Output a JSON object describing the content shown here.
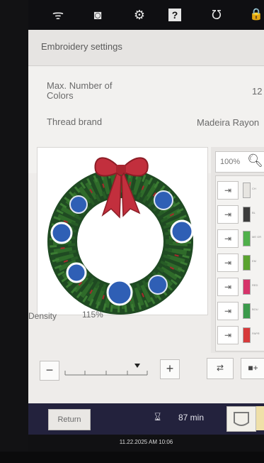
{
  "status_bar": {
    "icons": [
      "wifi-icon",
      "camera-icon",
      "gear-icon",
      "help-icon",
      "machine-icon",
      "lock-icon"
    ],
    "glyphs": [
      "ᯤ",
      "◙",
      "⚙",
      "?",
      "ᘮ",
      "🔒"
    ]
  },
  "header": {
    "title": "Embroidery settings"
  },
  "settings": {
    "max_colors_label_line1": "Max. Number of",
    "max_colors_label_line2": "Colors",
    "max_colors_value": "12",
    "thread_brand_label": "Thread brand",
    "thread_brand_value": "Madeira Rayon"
  },
  "preview": {
    "image": "christmas-wreath-embroidery"
  },
  "zoom": {
    "level": "100%"
  },
  "color_list": {
    "items": [
      {
        "color": "#e7e5e1",
        "name": "CH"
      },
      {
        "color": "#3c3c3c",
        "name": "BL"
      },
      {
        "color": "#4fb04a",
        "name": "ME GR"
      },
      {
        "color": "#5aa32f",
        "name": "EM"
      },
      {
        "color": "#d6336a",
        "name": "RED"
      },
      {
        "color": "#3b9a4b",
        "name": "BOU"
      },
      {
        "color": "#d73a3a",
        "name": "PAPR"
      }
    ]
  },
  "density": {
    "label": "Density",
    "value": "115%",
    "minus": "−",
    "plus": "+"
  },
  "actions": {
    "needle_swap": "⇄",
    "color_add": "■+"
  },
  "bottom": {
    "return_label": "Return",
    "time": "87 min"
  },
  "clock": {
    "text": "11.22.2025 AM 10:06"
  }
}
